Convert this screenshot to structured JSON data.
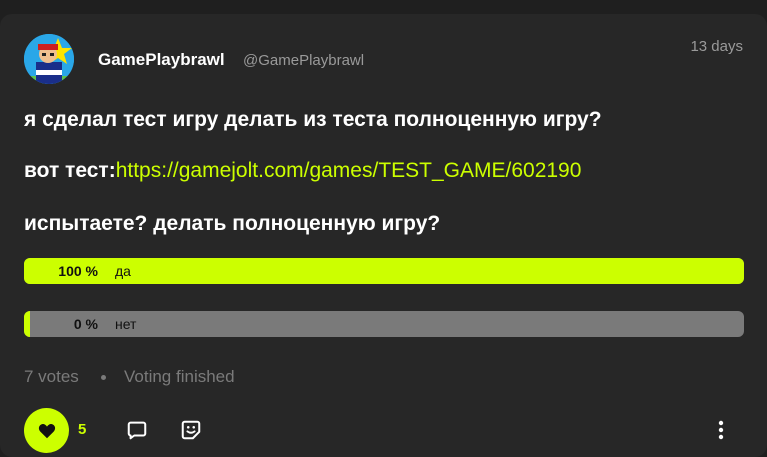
{
  "post": {
    "author": {
      "name": "GamePlaybrawl",
      "handle": "@GamePlaybrawl",
      "avatar_icon": "avatar-image"
    },
    "time": "13 days",
    "line1": "я сделал тест игру делать из теста полноценную игру?",
    "line2_prefix": "вот тест:",
    "line2_link": "https://gamejolt.com/games/TEST_GAME/602190",
    "line3": "испытаете? делать полноценную игру?"
  },
  "poll": {
    "options": [
      {
        "percent_label": "100 %",
        "label": "да",
        "percent": 100
      },
      {
        "percent_label": "0 %",
        "label": "нет",
        "percent": 0
      }
    ],
    "votes": "7 votes",
    "status": "Voting finished"
  },
  "actions": {
    "like_count": "5",
    "icons": [
      "heart-icon",
      "comment-icon",
      "share-icon",
      "more-vertical-icon"
    ]
  },
  "colors": {
    "accent": "#ccff00",
    "background": "#1f1f1f",
    "card": "#272727",
    "muted": "#7a7a7a"
  }
}
